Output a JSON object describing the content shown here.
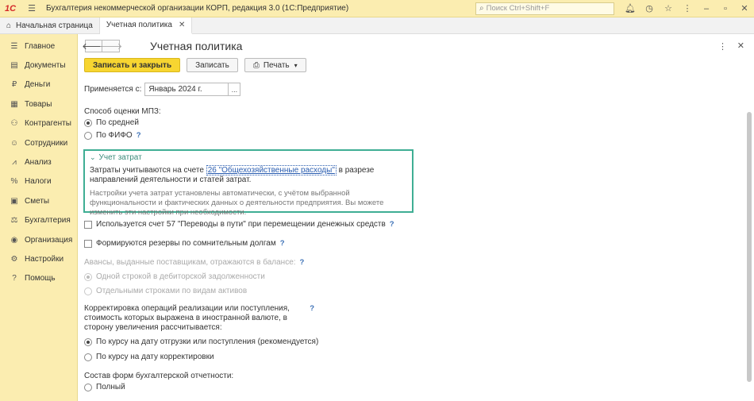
{
  "titlebar": {
    "logo": "1С",
    "app_title": "Бухгалтерия некоммерческой организации КОРП, редакция 3.0  (1С:Предприятие)",
    "search_placeholder": "Поиск Ctrl+Shift+F"
  },
  "tabs": {
    "home": "Начальная страница",
    "active": "Учетная политика"
  },
  "sidebar": {
    "items": [
      {
        "label": "Главное",
        "icon": "menu-icon"
      },
      {
        "label": "Документы",
        "icon": "document-icon"
      },
      {
        "label": "Деньги",
        "icon": "ruble-icon"
      },
      {
        "label": "Товары",
        "icon": "goods-icon"
      },
      {
        "label": "Контрагенты",
        "icon": "contractors-icon"
      },
      {
        "label": "Сотрудники",
        "icon": "user-icon"
      },
      {
        "label": "Анализ",
        "icon": "chart-icon"
      },
      {
        "label": "Налоги",
        "icon": "percent-icon"
      },
      {
        "label": "Сметы",
        "icon": "estimate-icon"
      },
      {
        "label": "Бухгалтерия",
        "icon": "accounting-icon"
      },
      {
        "label": "Организация",
        "icon": "organization-icon"
      },
      {
        "label": "Настройки",
        "icon": "gear-icon"
      },
      {
        "label": "Помощь",
        "icon": "help-icon"
      }
    ]
  },
  "form": {
    "title": "Учетная политика",
    "buttons": {
      "save_close": "Записать и закрыть",
      "save": "Записать",
      "print": "Печать"
    },
    "applies_label": "Применяется с:",
    "applies_value": "Январь 2024 г.",
    "input_btn": "...",
    "mpz_label": "Способ оценки МПЗ:",
    "mpz_avg": "По средней",
    "mpz_fifo": "По ФИФО",
    "q": "?",
    "cost": {
      "title": "Учет затрат",
      "text_before": "Затраты учитываются на счете ",
      "link": "26 \"Общехозяйственные расходы\"",
      "text_after": " в разрезе направлений деятельности и статей затрат.",
      "note": "Настройки учета затрат установлены автоматически, с учётом выбранной функциональности и фактических данных о деятельности предприятия. Вы можете изменить эти настройки при необходимости."
    },
    "acc57": "Используется счет 57 \"Переводы в пути\" при перемещении денежных средств",
    "reserves": "Формируются резервы по сомнительным долгам",
    "advances_label": "Авансы, выданные поставщикам, отражаются в балансе:",
    "advances_one": "Одной строкой в дебиторской задолженности",
    "advances_sep": "Отдельными строками по видам активов",
    "fx_label": "Корректировка операций реализации или поступления, стоимость которых выражена в иностранной валюте, в сторону увеличения рассчитывается:",
    "fx_ship": "По курсу на дату отгрузки или поступления (рекомендуется)",
    "fx_corr": "По курсу на дату корректировки",
    "report_label": "Состав форм бухгалтерской отчетности:",
    "report_full": "Полный"
  }
}
